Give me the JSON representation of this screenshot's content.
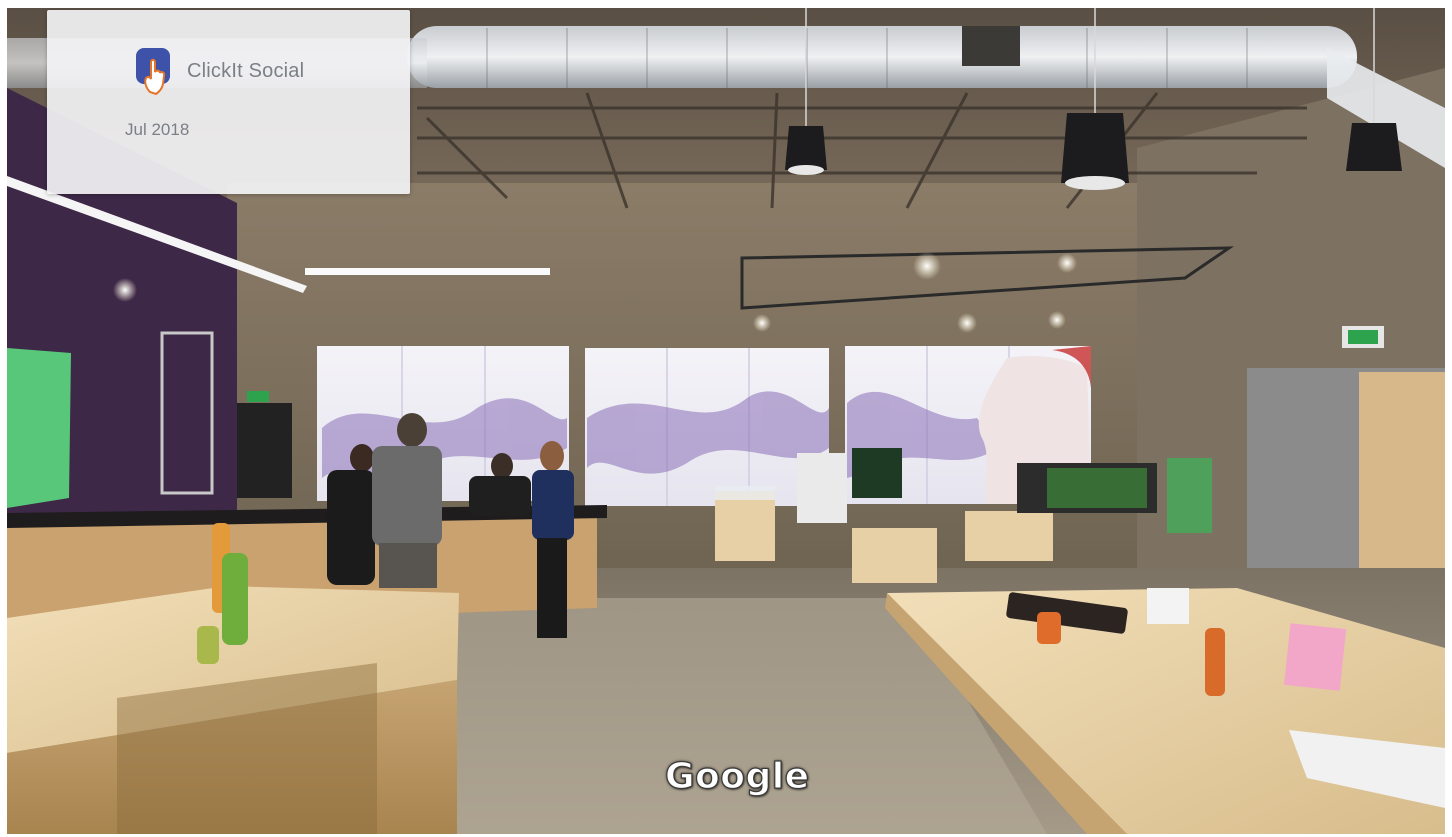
{
  "info_card": {
    "place_name": "ClickIt Social",
    "date": "Jul 2018"
  },
  "watermark": {
    "text": "Google"
  },
  "icons": {
    "place": "hand-pointer-icon"
  },
  "colors": {
    "card_bg": "#f3f3f5",
    "card_text": "#7b7f86",
    "icon_blue": "#3d52a8",
    "icon_orange": "#e3762b"
  }
}
